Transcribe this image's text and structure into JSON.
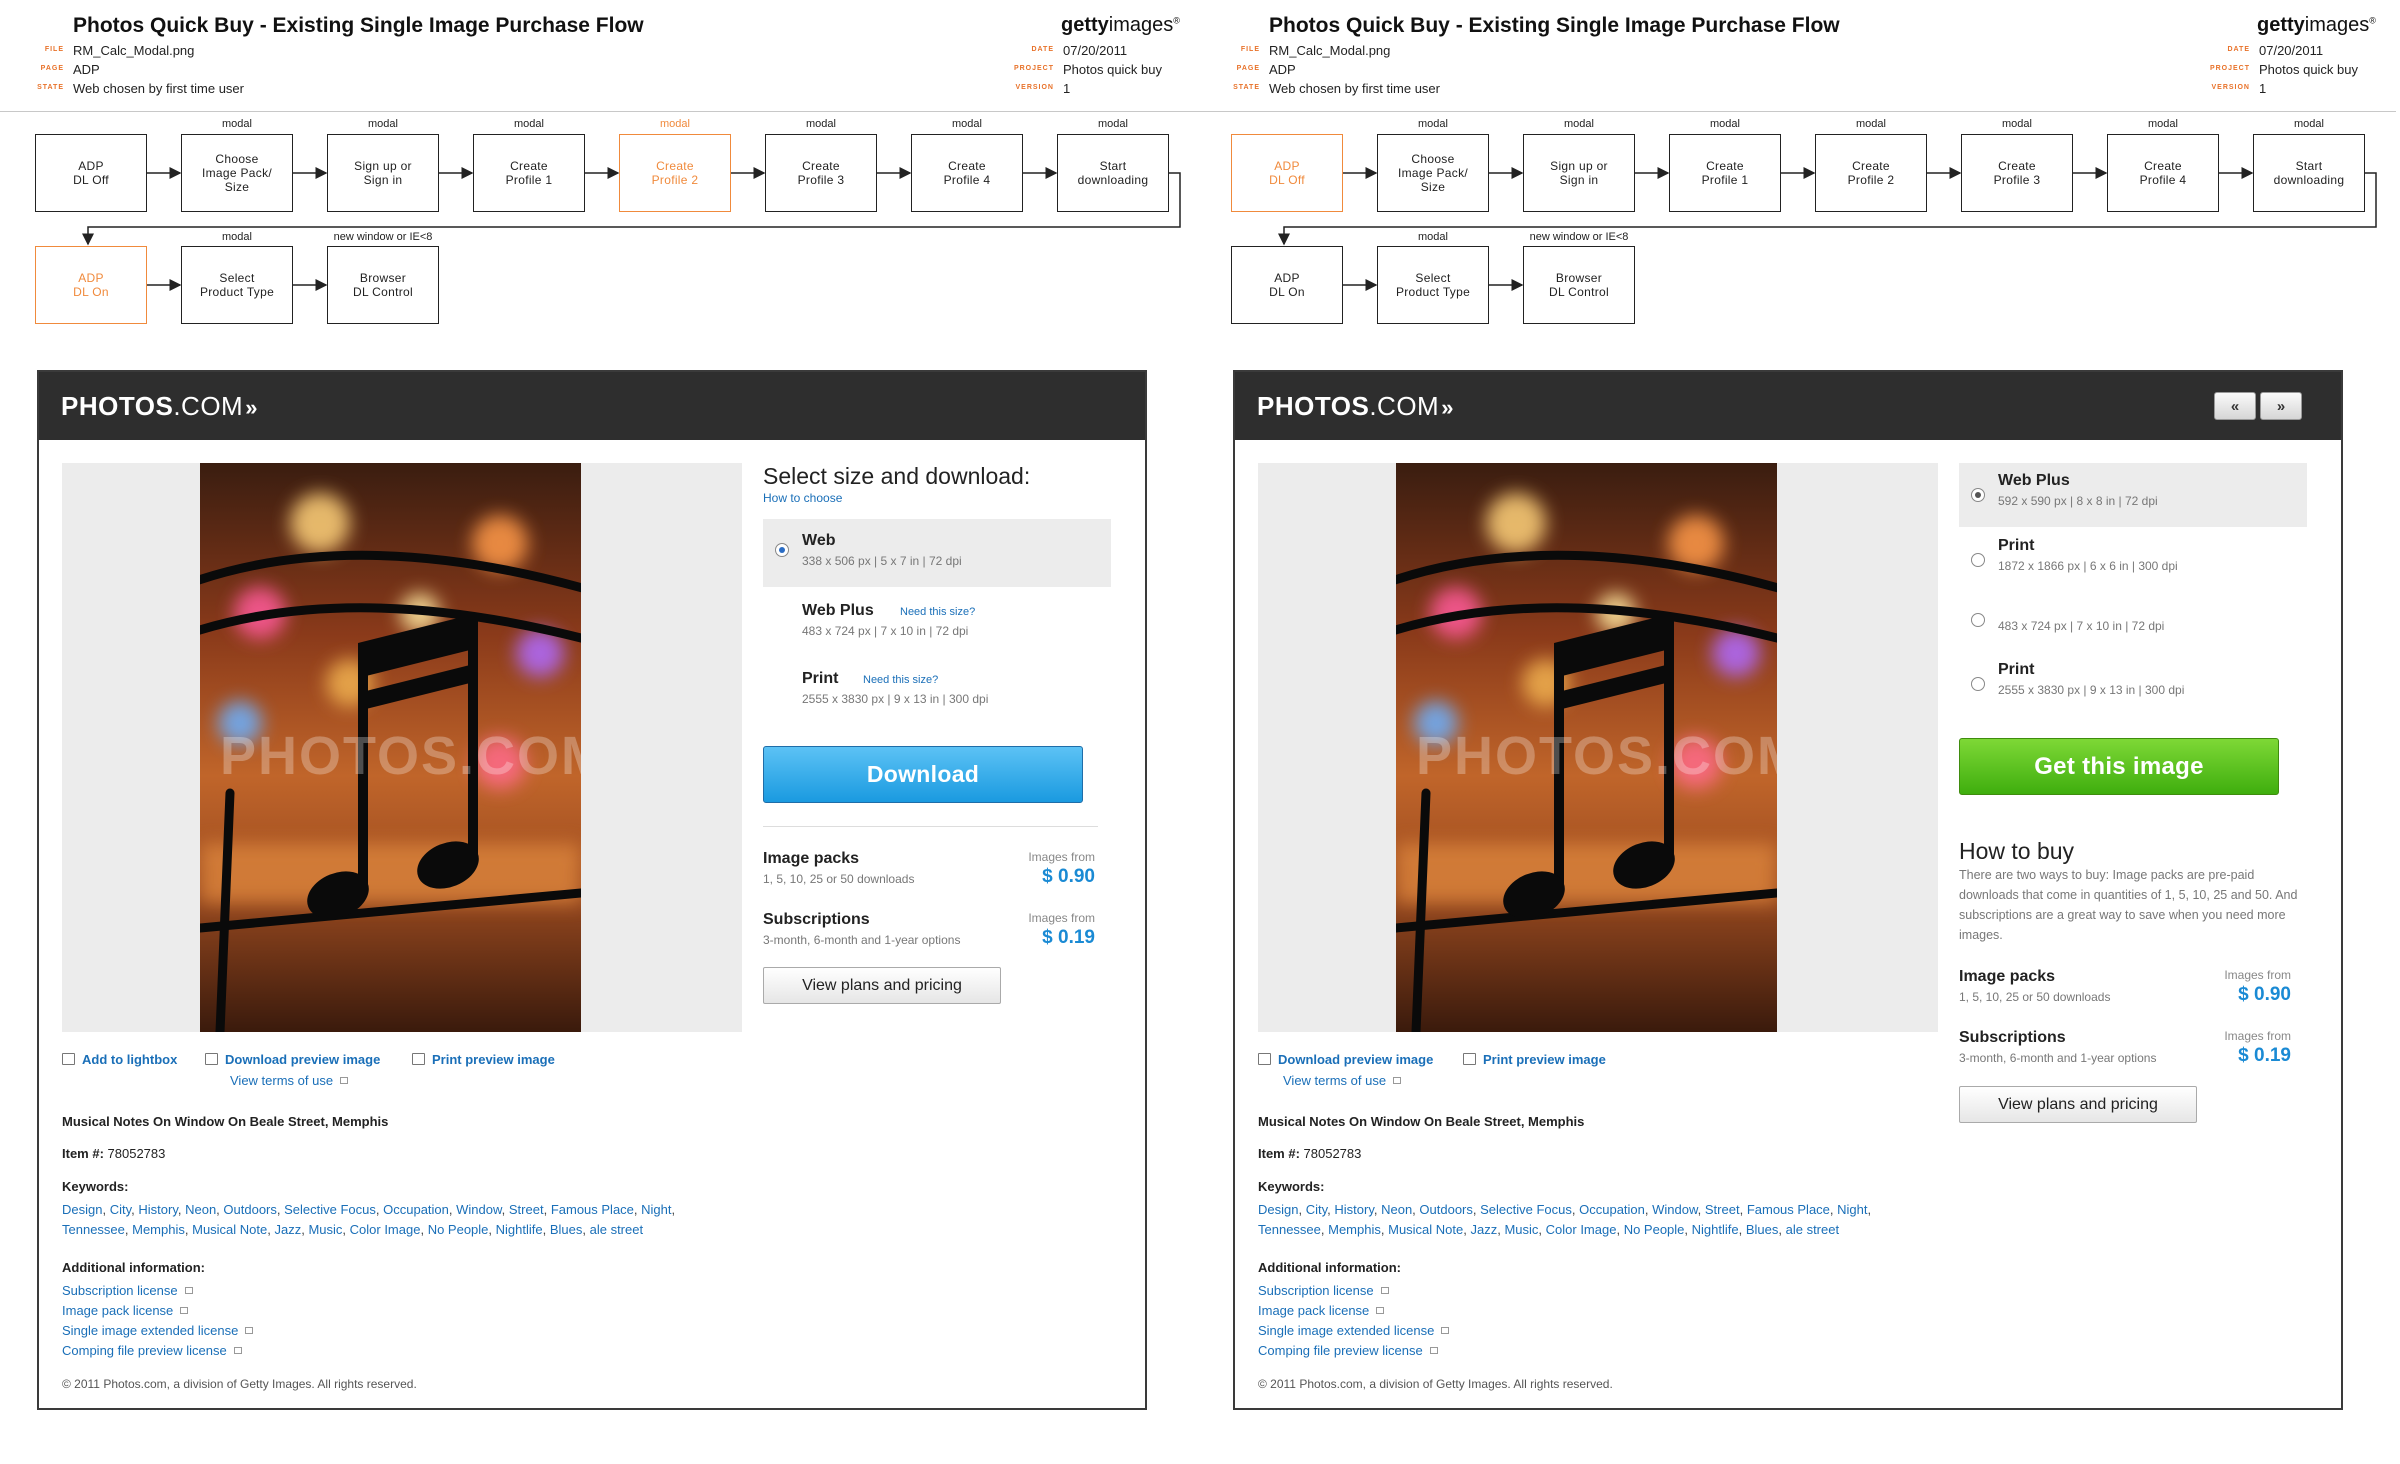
{
  "doc": {
    "title": "Photos Quick Buy - Existing Single Image Purchase Flow",
    "labels": {
      "file": "FILE",
      "page": "PAGE",
      "state": "STATE",
      "date": "DATE",
      "project": "PROJECT",
      "version": "VERSION"
    },
    "file": "RM_Calc_Modal.png",
    "page": "ADP",
    "state": "Web chosen by first time user",
    "date": "07/20/2011",
    "project": "Photos quick buy",
    "version": "1",
    "logo_bold": "getty",
    "logo_light": "images",
    "logo_mark": "®"
  },
  "flow": {
    "modal": "modal",
    "new_window": "new window or IE<8",
    "row1": [
      "ADP\nDL Off",
      "Choose\nImage Pack/\nSize",
      "Sign up or\nSign in",
      "Create\nProfile 1",
      "Create\nProfile 2",
      "Create\nProfile 3",
      "Create\nProfile 4",
      "Start\ndownloading"
    ],
    "row2": [
      "ADP\nDL On",
      "Select\nProduct Type",
      "Browser\nDL Control"
    ]
  },
  "site": {
    "brand_bold": "PHOTOS",
    "brand_light": ".COM",
    "brand_chev": "»",
    "nav_prev": "«",
    "nav_next": "»",
    "watermark": "PHOTOS.COM",
    "add_lightbox": "Add to lightbox",
    "download_preview": "Download preview image",
    "print_preview": "Print preview image",
    "view_terms": "View terms of use",
    "image_title": "Musical Notes On Window On Beale Street, Memphis",
    "item_label": "Item #:",
    "item_number": "78052783",
    "keywords_label": "Keywords:",
    "keywords_line1": [
      "Design",
      "City",
      "History",
      "Neon",
      "Outdoors",
      "Selective Focus",
      "Occupation",
      "Window",
      "Street",
      "Famous Place",
      "Night"
    ],
    "keywords_line2": [
      "Tennessee",
      "Memphis",
      "Musical Note",
      "Jazz",
      "Music",
      "Color Image",
      "No People",
      "Nightlife",
      "Blues",
      "ale street"
    ],
    "additional_label": "Additional information:",
    "licenses": [
      "Subscription license",
      "Image pack license",
      "Single image extended license",
      "Comping file preview license"
    ],
    "copyright": "© 2011 Photos.com, a division of Getty Images.  All rights reserved.",
    "image_packs": "Image packs",
    "image_packs_desc": "1, 5, 10, 25 or 50 downloads",
    "images_from": "Images from",
    "pack_price": "$ 0.90",
    "subscriptions": "Subscriptions",
    "subscriptions_desc": "3-month, 6-month and 1-year options",
    "sub_price": "$ 0.19",
    "view_plans": "View plans and pricing"
  },
  "left": {
    "select_title": "Select size and download:",
    "how_to_choose": "How to choose",
    "need_size": "Need this size?",
    "options": [
      {
        "name": "Web",
        "spec": "338 x 506 px | 5 x 7 in | 72 dpi"
      },
      {
        "name": "Web Plus",
        "spec": "483 x 724 px | 7 x 10 in | 72 dpi"
      },
      {
        "name": "Print",
        "spec": "2555 x 3830 px | 9 x 13 in | 300 dpi"
      }
    ],
    "download": "Download"
  },
  "right": {
    "options": [
      {
        "name": "Web Plus",
        "spec": "592 x 590 px | 8 x 8 in | 72 dpi"
      },
      {
        "name": "Print",
        "spec": "1872 x 1866 px | 6 x 6 in | 300 dpi"
      },
      {
        "name": "",
        "spec": "483 x 724 px | 7 x 10 in | 72 dpi"
      },
      {
        "name": "Print",
        "spec": "2555 x 3830 px | 9 x 13 in | 300 dpi"
      }
    ],
    "get_image": "Get this image",
    "how_to_buy": "How to buy",
    "how_to_buy_text": "There are two ways to buy: Image packs are pre-paid downloads that come in quantities of 1, 5, 10, 25 and 50. And subscriptions are a great way to save when you need more images."
  },
  "colors": {
    "accent_orange": "#f08a3c",
    "link_blue": "#1a6fb8",
    "price_blue": "#1a8ad4",
    "download_blue": "#1a9ae0",
    "get_green": "#3fae0e",
    "dark_bar": "#2e2e2e"
  }
}
